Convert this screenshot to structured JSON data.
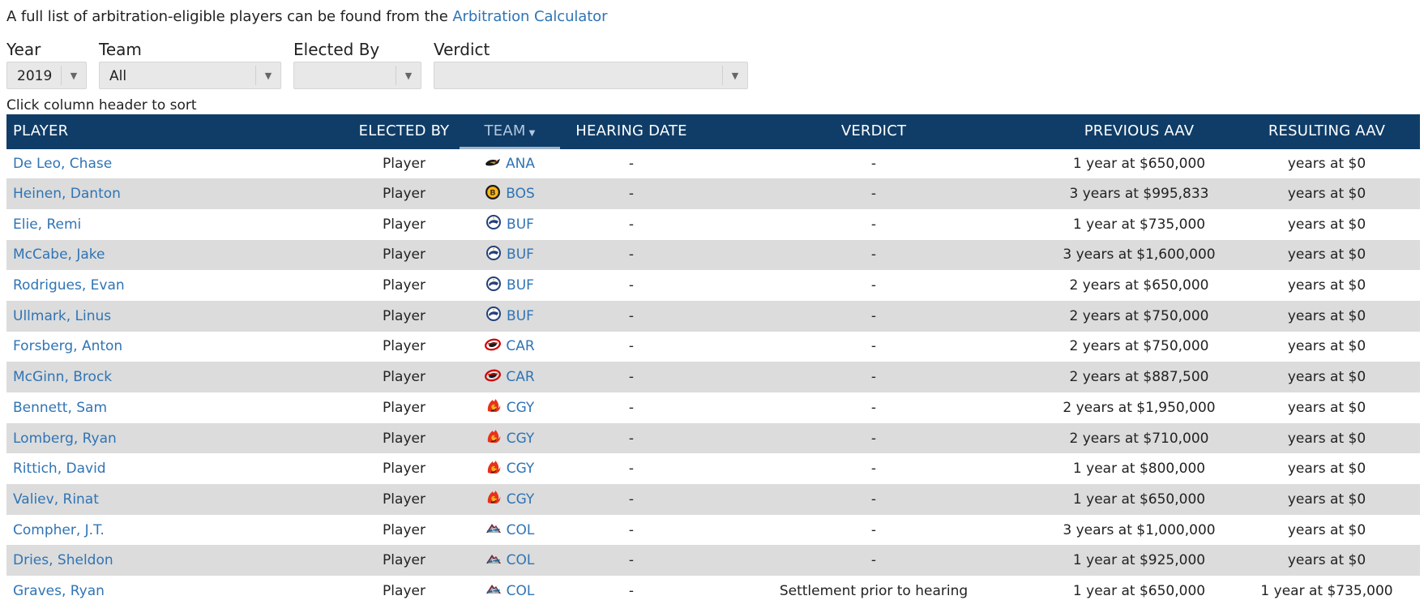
{
  "intro": {
    "text": "A full list of arbitration-eligible players can be found from the ",
    "link": "Arbitration Calculator"
  },
  "filters": [
    {
      "label": "Year",
      "value": "2019"
    },
    {
      "label": "Team",
      "value": "All"
    },
    {
      "label": "Elected By",
      "value": ""
    },
    {
      "label": "Verdict",
      "value": ""
    }
  ],
  "sort_hint": "Click column header to sort",
  "columns": [
    "PLAYER",
    "ELECTED BY",
    "TEAM",
    "HEARING DATE",
    "VERDICT",
    "PREVIOUS AAV",
    "RESULTING AAV"
  ],
  "sorted_column": "TEAM",
  "icons": {
    "dropdown": "chevron-down-icon",
    "sort": "sort-desc-icon"
  },
  "colors": {
    "header_bg": "#0f3d68",
    "link": "#2f74b5",
    "row_alt": "#dcdcdc"
  },
  "rows": [
    {
      "player": "De Leo, Chase",
      "elected": "Player",
      "team": "ANA",
      "hearing": "-",
      "verdict": "-",
      "prev": "1 year at $650,000",
      "result": "years at $0"
    },
    {
      "player": "Heinen, Danton",
      "elected": "Player",
      "team": "BOS",
      "hearing": "-",
      "verdict": "-",
      "prev": "3 years at $995,833",
      "result": "years at $0"
    },
    {
      "player": "Elie, Remi",
      "elected": "Player",
      "team": "BUF",
      "hearing": "-",
      "verdict": "-",
      "prev": "1 year at $735,000",
      "result": "years at $0"
    },
    {
      "player": "McCabe, Jake",
      "elected": "Player",
      "team": "BUF",
      "hearing": "-",
      "verdict": "-",
      "prev": "3 years at $1,600,000",
      "result": "years at $0"
    },
    {
      "player": "Rodrigues, Evan",
      "elected": "Player",
      "team": "BUF",
      "hearing": "-",
      "verdict": "-",
      "prev": "2 years at $650,000",
      "result": "years at $0"
    },
    {
      "player": "Ullmark, Linus",
      "elected": "Player",
      "team": "BUF",
      "hearing": "-",
      "verdict": "-",
      "prev": "2 years at $750,000",
      "result": "years at $0"
    },
    {
      "player": "Forsberg, Anton",
      "elected": "Player",
      "team": "CAR",
      "hearing": "-",
      "verdict": "-",
      "prev": "2 years at $750,000",
      "result": "years at $0"
    },
    {
      "player": "McGinn, Brock",
      "elected": "Player",
      "team": "CAR",
      "hearing": "-",
      "verdict": "-",
      "prev": "2 years at $887,500",
      "result": "years at $0"
    },
    {
      "player": "Bennett, Sam",
      "elected": "Player",
      "team": "CGY",
      "hearing": "-",
      "verdict": "-",
      "prev": "2 years at $1,950,000",
      "result": "years at $0"
    },
    {
      "player": "Lomberg, Ryan",
      "elected": "Player",
      "team": "CGY",
      "hearing": "-",
      "verdict": "-",
      "prev": "2 years at $710,000",
      "result": "years at $0"
    },
    {
      "player": "Rittich, David",
      "elected": "Player",
      "team": "CGY",
      "hearing": "-",
      "verdict": "-",
      "prev": "1 year at $800,000",
      "result": "years at $0"
    },
    {
      "player": "Valiev, Rinat",
      "elected": "Player",
      "team": "CGY",
      "hearing": "-",
      "verdict": "-",
      "prev": "1 year at $650,000",
      "result": "years at $0"
    },
    {
      "player": "Compher, J.T.",
      "elected": "Player",
      "team": "COL",
      "hearing": "-",
      "verdict": "-",
      "prev": "3 years at $1,000,000",
      "result": "years at $0"
    },
    {
      "player": "Dries, Sheldon",
      "elected": "Player",
      "team": "COL",
      "hearing": "-",
      "verdict": "-",
      "prev": "1 year at $925,000",
      "result": "years at $0"
    },
    {
      "player": "Graves, Ryan",
      "elected": "Player",
      "team": "COL",
      "hearing": "-",
      "verdict": "Settlement prior to hearing",
      "prev": "1 year at $650,000",
      "result": "1 year at $735,000"
    }
  ]
}
